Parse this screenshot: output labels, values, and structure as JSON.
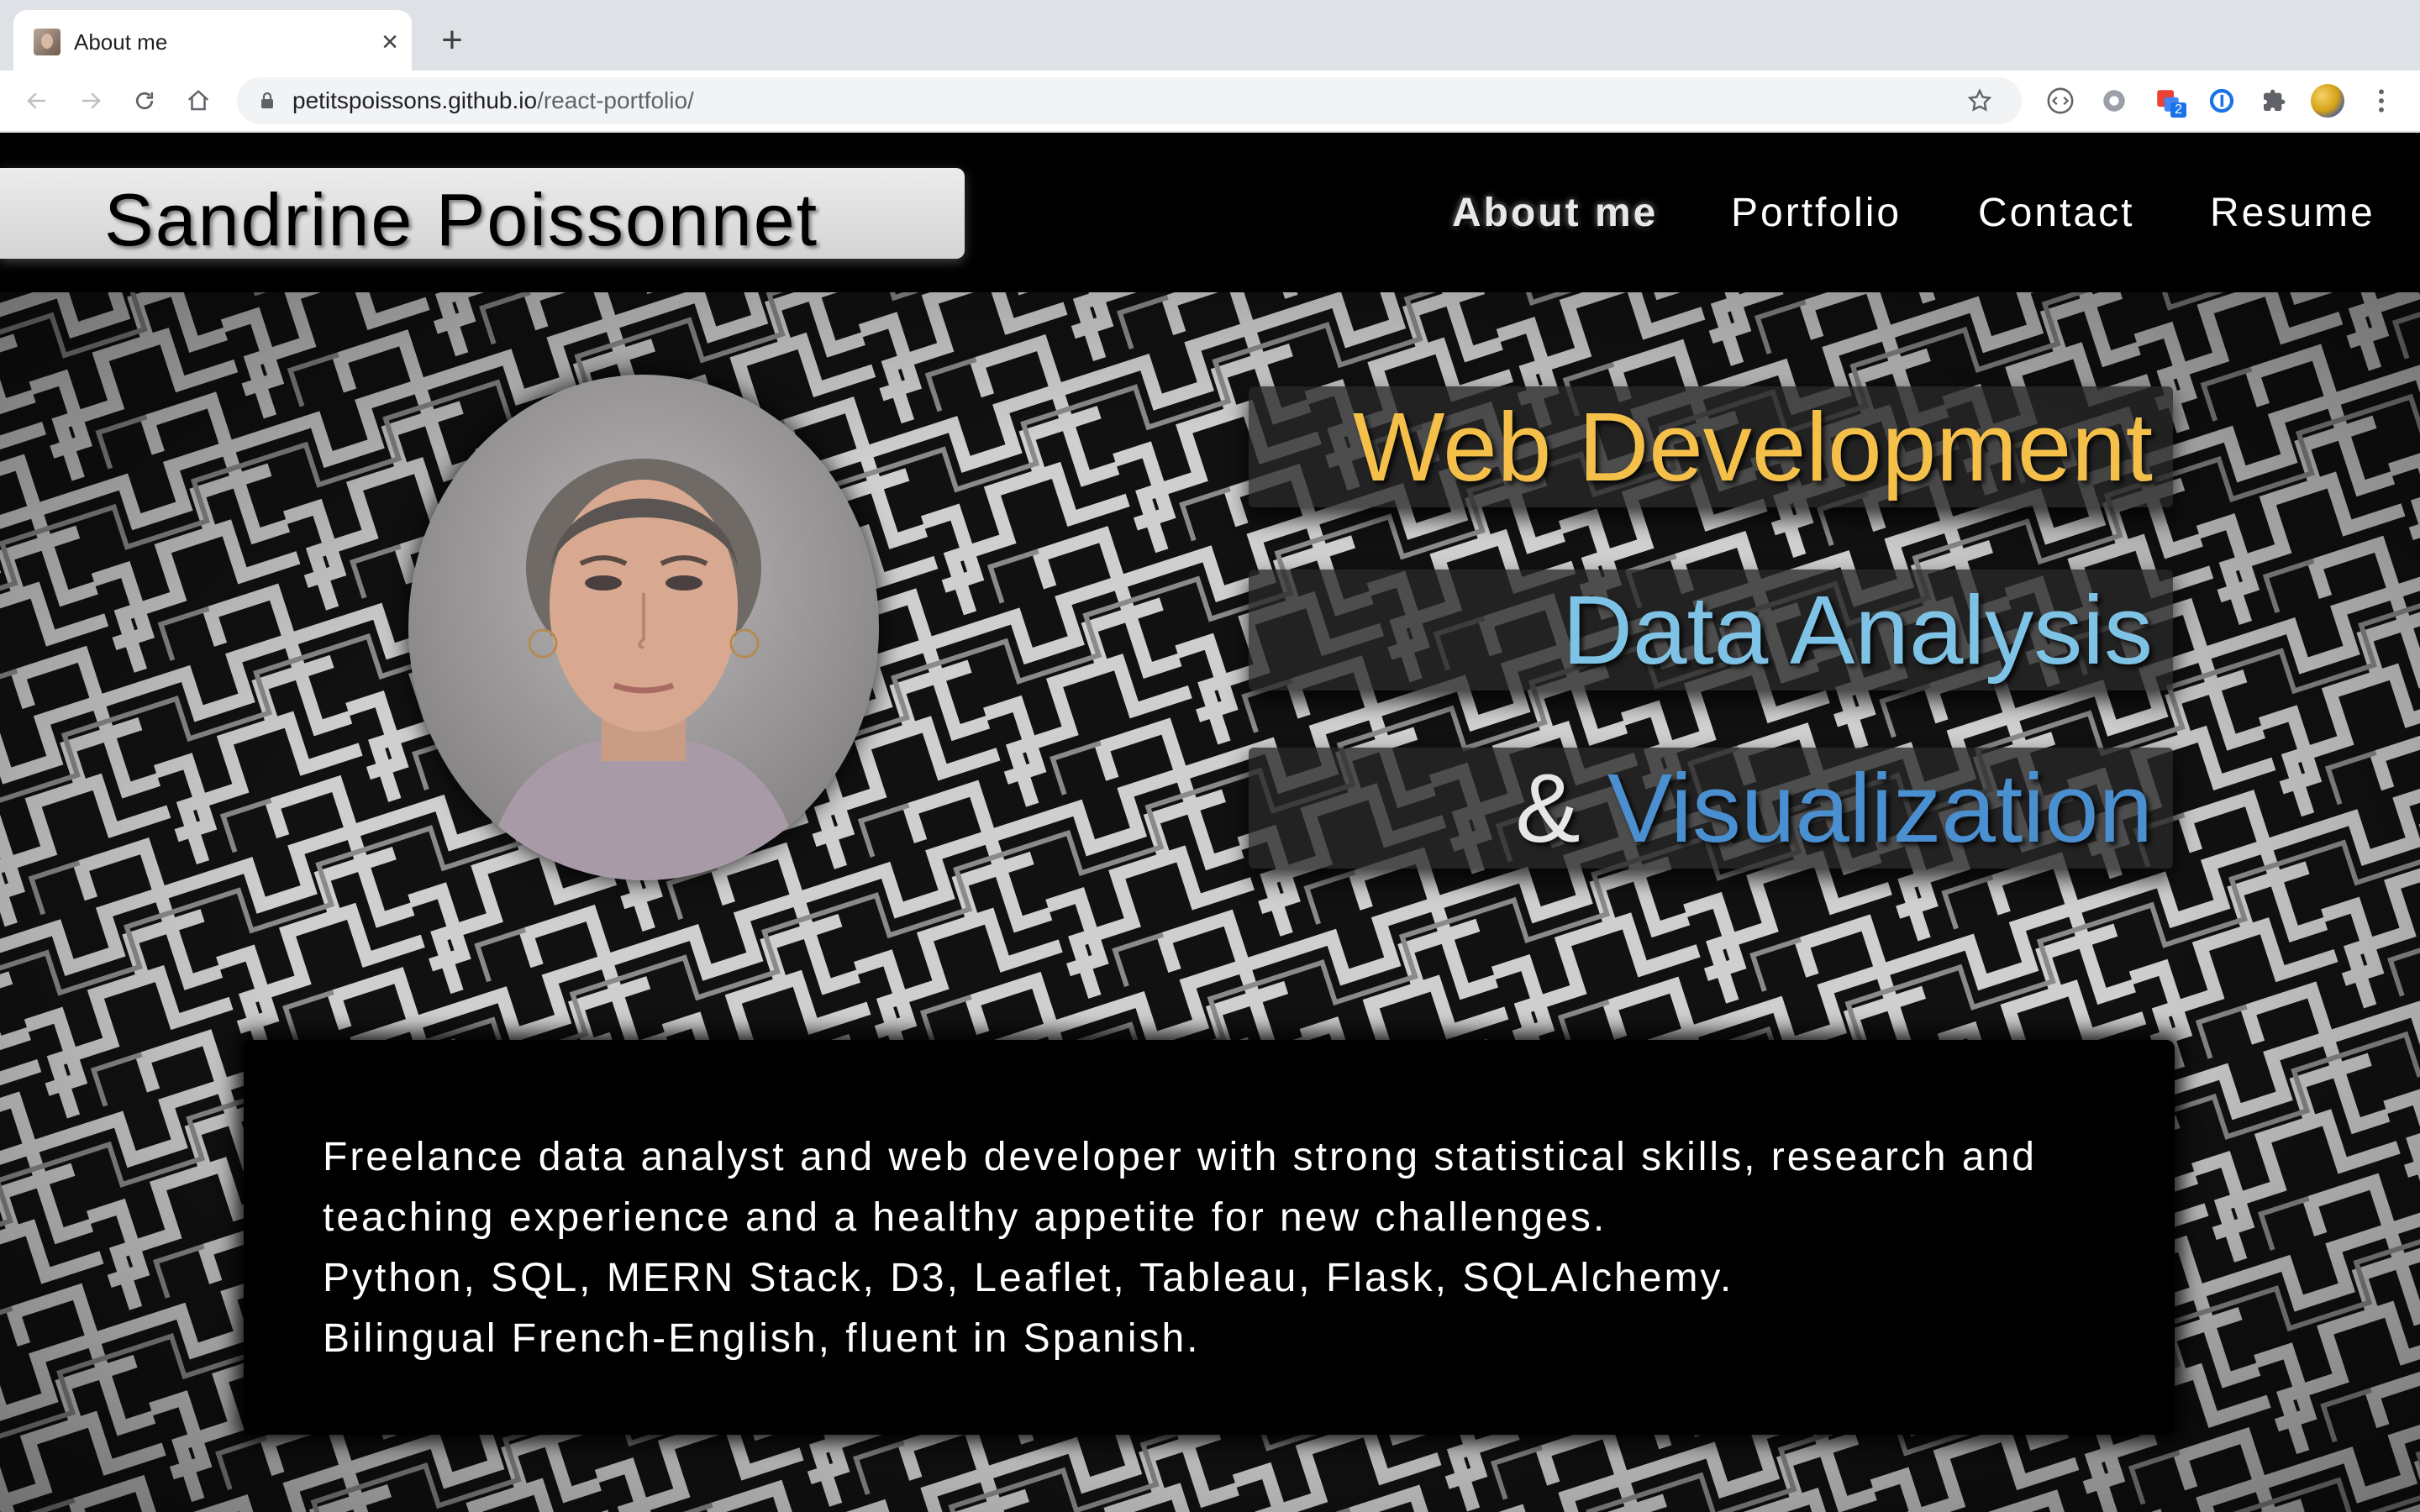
{
  "browser": {
    "tab_title": "About me",
    "url_host": "petitspoissons.github.io",
    "url_path": "/react-portfolio/",
    "extension_badge": "2"
  },
  "header": {
    "site_name": "Sandrine Poissonnet",
    "nav": [
      {
        "label": "About me",
        "active": true
      },
      {
        "label": "Portfolio",
        "active": false
      },
      {
        "label": "Contact",
        "active": false
      },
      {
        "label": "Resume",
        "active": false
      }
    ]
  },
  "hero": {
    "tagline_1": "Web Development",
    "tagline_2": "Data Analysis",
    "tagline_3_prefix": "&",
    "tagline_3": "Visualization",
    "colors": {
      "tagline_1": "#f5c04a",
      "tagline_2": "#7ec3e6",
      "tagline_3": "#4a8fd0",
      "ampersand": "#e6e6e6"
    }
  },
  "bio": {
    "lines": [
      "Freelance data analyst and web developer with strong statistical skills, research and",
      "teaching experience and a healthy appetite for new challenges.",
      "Python, SQL, MERN Stack, D3, Leaflet, Tableau, Flask, SQLAlchemy.",
      "Bilingual French-English, fluent in Spanish."
    ]
  }
}
